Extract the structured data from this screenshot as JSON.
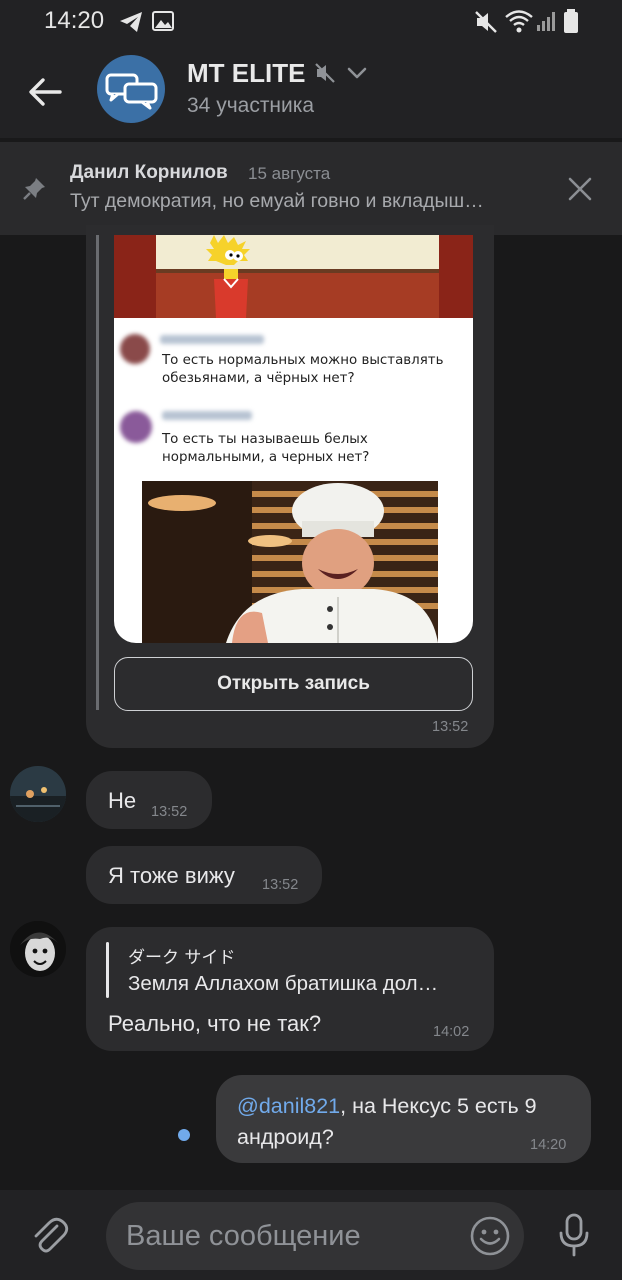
{
  "status_bar": {
    "time": "14:20"
  },
  "header": {
    "title": "MT ELITE",
    "subtitle": "34 участника"
  },
  "pinned": {
    "author": "Данил Корнилов",
    "date": "15 августа",
    "text": "Тут демократия, но емуай говно и вкладыш…"
  },
  "shared_post": {
    "comment1": "То есть нормальных можно выставлять обезьянами, а чёрных нет?",
    "comment2": "То есть ты называешь белых нормальными, а черных нет?",
    "open_button": "Открыть запись",
    "time": "13:52"
  },
  "messages": [
    {
      "text": "Не",
      "time": "13:52"
    },
    {
      "text": "Я тоже вижу",
      "time": "13:52"
    },
    {
      "reply_author": "ダーク サイド",
      "reply_text": "Земля Аллахом братишка дол…",
      "text": "Реально, что не так?",
      "time": "14:02"
    },
    {
      "mention": "@danil821",
      "text": ", на Нексус 5 есть 9 андроид?",
      "time": "14:20"
    }
  ],
  "composer": {
    "placeholder": "Ваше сообщение"
  },
  "colors": {
    "accent": "#3b70a6",
    "link": "#71aaeb",
    "background": "#19191a",
    "bubble": "#2c2c2e",
    "outgoing_bubble": "#3a3a3c"
  }
}
